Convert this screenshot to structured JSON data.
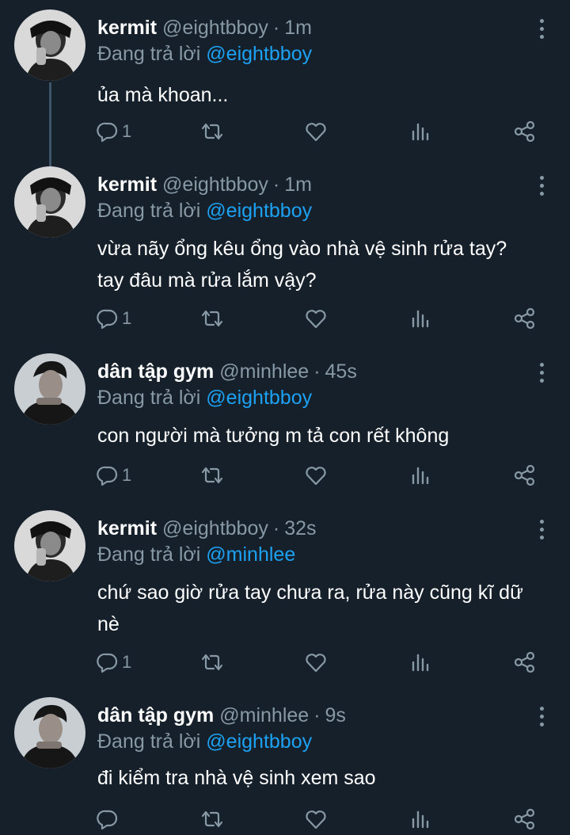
{
  "replying_prefix": "Đang trả lời",
  "tweets": [
    {
      "name": "kermit",
      "handle": "@eightbboy",
      "sep": "·",
      "time": "1m",
      "reply_to": "@eightbboy",
      "text": "ủa mà khoan...",
      "reply_count": "1"
    },
    {
      "name": "kermit",
      "handle": "@eightbboy",
      "sep": "·",
      "time": "1m",
      "reply_to": "@eightbboy",
      "text": "vừa nãy ổng kêu ổng vào nhà vệ sinh rửa tay? tay đâu mà rửa lắm vậy?",
      "reply_count": "1"
    },
    {
      "name": "dân tập gym",
      "handle": "@minhlee",
      "sep": "·",
      "time": "45s",
      "reply_to": "@eightbboy",
      "text": "con người mà tưởng m tả con rết không",
      "reply_count": "1"
    },
    {
      "name": "kermit",
      "handle": "@eightbboy",
      "sep": "·",
      "time": "32s",
      "reply_to": "@minhlee",
      "text": "chứ sao giờ rửa tay chưa ra, rửa này cũng kĩ dữ nè",
      "reply_count": "1"
    },
    {
      "name": "dân tập gym",
      "handle": "@minhlee",
      "sep": "·",
      "time": "9s",
      "reply_to": "@eightbboy",
      "text": "đi kiểm tra nhà vệ sinh xem sao",
      "reply_count": ""
    }
  ],
  "icons": {
    "reply": "reply-icon",
    "retweet": "retweet-icon",
    "like": "heart-icon",
    "stats": "analytics-icon",
    "share": "share-icon",
    "more": "more-vertical-icon"
  },
  "colors": {
    "background": "#15202b",
    "text": "#ffffff",
    "secondary": "#8899a6",
    "mention": "#1da1f2",
    "thread_line": "#3d5466"
  }
}
